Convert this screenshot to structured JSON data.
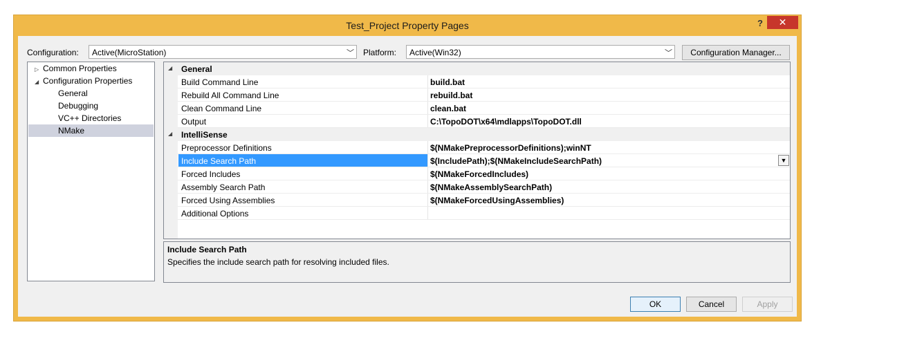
{
  "window": {
    "title": "Test_Project Property Pages",
    "help_label": "?",
    "close_label": "✕"
  },
  "toolbar": {
    "configuration_label": "Configuration:",
    "configuration_value": "Active(MicroStation)",
    "platform_label": "Platform:",
    "platform_value": "Active(Win32)",
    "config_manager_label": "Configuration Manager..."
  },
  "tree": {
    "items": [
      {
        "label": "Common Properties",
        "toggle": "▷"
      },
      {
        "label": "Configuration Properties",
        "toggle": "◢"
      },
      {
        "label": "General"
      },
      {
        "label": "Debugging"
      },
      {
        "label": "VC++ Directories"
      },
      {
        "label": "NMake",
        "selected": true
      }
    ]
  },
  "grid": {
    "categories": [
      {
        "label": "General",
        "toggle": "◢"
      },
      {
        "label": "IntelliSense",
        "toggle": "◢"
      }
    ],
    "rows": [
      {
        "name": "Build Command Line",
        "value": "build.bat"
      },
      {
        "name": "Rebuild All Command Line",
        "value": "rebuild.bat"
      },
      {
        "name": "Clean Command Line",
        "value": "clean.bat"
      },
      {
        "name": "Output",
        "value": "C:\\TopoDOT\\x64\\mdlapps\\TopoDOT.dll"
      },
      {
        "name": "Preprocessor Definitions",
        "value": "$(NMakePreprocessorDefinitions);winNT"
      },
      {
        "name": "Include Search Path",
        "value": "$(IncludePath);$(NMakeIncludeSearchPath)",
        "selected": true
      },
      {
        "name": "Forced Includes",
        "value": "$(NMakeForcedIncludes)"
      },
      {
        "name": "Assembly Search Path",
        "value": "$(NMakeAssemblySearchPath)"
      },
      {
        "name": "Forced Using Assemblies",
        "value": "$(NMakeForcedUsingAssemblies)"
      },
      {
        "name": "Additional Options",
        "value": ""
      }
    ]
  },
  "description": {
    "title": "Include Search Path",
    "text": "Specifies the include search path for resolving included files."
  },
  "buttons": {
    "ok": "OK",
    "cancel": "Cancel",
    "apply": "Apply"
  },
  "colors": {
    "window_frame": "#f0b949",
    "close_button": "#c7362b",
    "selection": "#3399ff"
  }
}
